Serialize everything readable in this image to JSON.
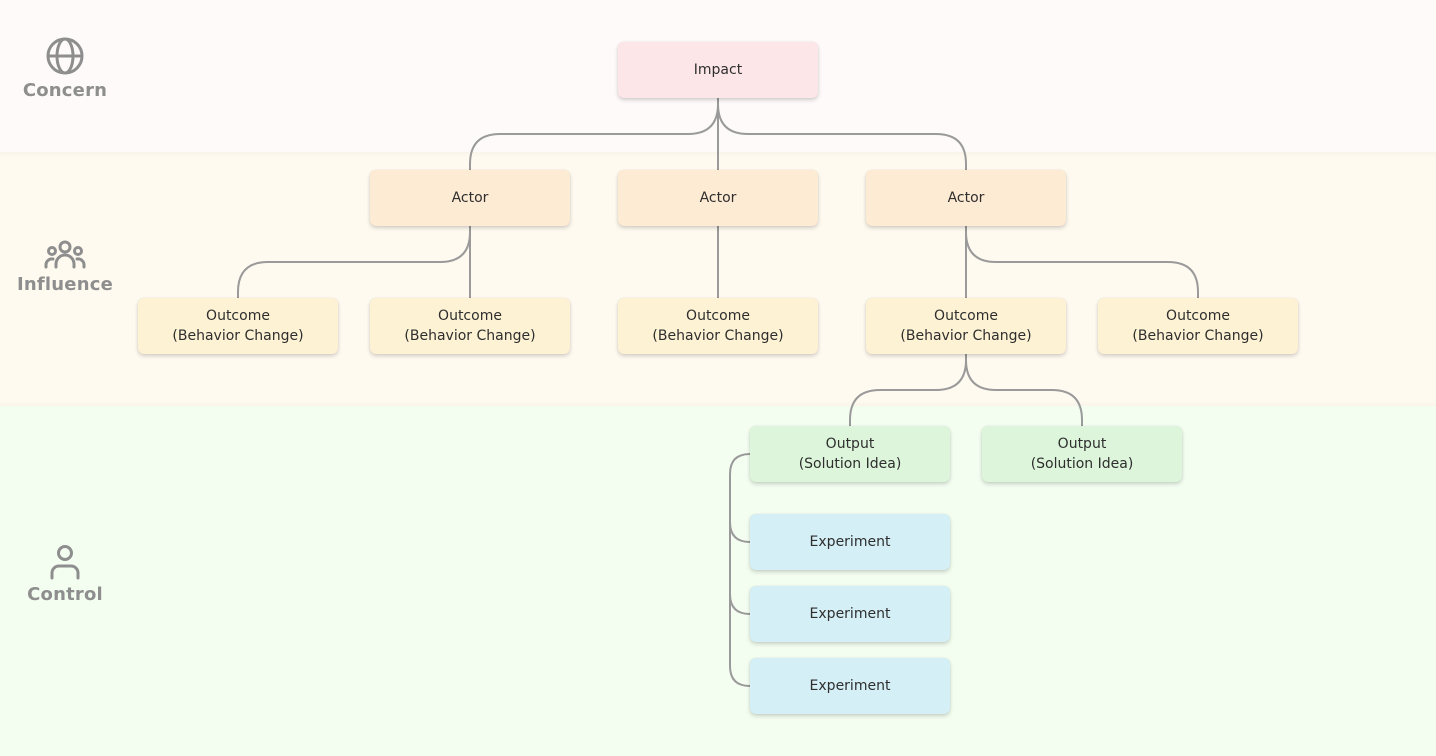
{
  "bands": [
    {
      "id": "concern",
      "label": "Concern",
      "icon": "globe-icon",
      "color": "#fefafa"
    },
    {
      "id": "influence",
      "label": "Influence",
      "icon": "people-group-icon",
      "color": "#fffaf0"
    },
    {
      "id": "control",
      "label": "Control",
      "icon": "person-icon",
      "color": "#f3fef1"
    }
  ],
  "node_colors": {
    "impact": "#fde6e8",
    "actor": "#fdebd3",
    "outcome": "#fdf2d4",
    "output": "#ddf6db",
    "experiment": "#d5eff6",
    "connector": "#9a9a9a"
  },
  "nodes": {
    "impact": {
      "line1": "Impact"
    },
    "actor1": {
      "line1": "Actor"
    },
    "actor2": {
      "line1": "Actor"
    },
    "actor3": {
      "line1": "Actor"
    },
    "outcome1": {
      "line1": "Outcome",
      "line2": "(Behavior Change)"
    },
    "outcome2": {
      "line1": "Outcome",
      "line2": "(Behavior Change)"
    },
    "outcome3": {
      "line1": "Outcome",
      "line2": "(Behavior Change)"
    },
    "outcome4": {
      "line1": "Outcome",
      "line2": "(Behavior Change)"
    },
    "outcome5": {
      "line1": "Outcome",
      "line2": "(Behavior Change)"
    },
    "output1": {
      "line1": "Output",
      "line2": "(Solution Idea)"
    },
    "output2": {
      "line1": "Output",
      "line2": "(Solution Idea)"
    },
    "experiment1": {
      "line1": "Experiment"
    },
    "experiment2": {
      "line1": "Experiment"
    },
    "experiment3": {
      "line1": "Experiment"
    }
  },
  "edges": [
    [
      "impact",
      "actor1"
    ],
    [
      "impact",
      "actor2"
    ],
    [
      "impact",
      "actor3"
    ],
    [
      "actor1",
      "outcome1"
    ],
    [
      "actor1",
      "outcome2"
    ],
    [
      "actor2",
      "outcome3"
    ],
    [
      "actor3",
      "outcome4"
    ],
    [
      "actor3",
      "outcome5"
    ],
    [
      "outcome4",
      "output1"
    ],
    [
      "outcome4",
      "output2"
    ],
    [
      "output1",
      "experiment1"
    ],
    [
      "output1",
      "experiment2"
    ],
    [
      "output1",
      "experiment3"
    ]
  ]
}
